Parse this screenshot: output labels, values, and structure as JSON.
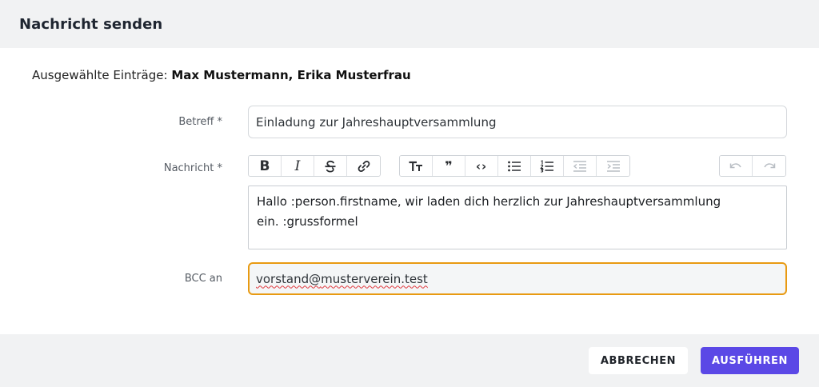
{
  "dialog": {
    "title": "Nachricht senden"
  },
  "selection": {
    "prefix": "Ausgewählte Einträge:",
    "names": "Max Mustermann, Erika Musterfrau"
  },
  "form": {
    "subject": {
      "label": "Betreff *",
      "value": "Einladung zur Jahreshauptversammlung"
    },
    "message": {
      "label": "Nachricht *",
      "line1": "Hallo :person.firstname, wir laden dich herzlich zur Jahreshauptversammlung",
      "line2": "ein. :grussformel"
    },
    "bcc": {
      "label": "BCC an",
      "value_plain": "vorstand@",
      "value_flagged": "musterverein.test"
    }
  },
  "toolbar": {
    "icons": [
      "bold-icon",
      "italic-icon",
      "strikethrough-icon",
      "link-icon",
      "heading-icon",
      "quote-icon",
      "code-icon",
      "bullet-list-icon",
      "numbered-list-icon",
      "outdent-icon",
      "indent-icon",
      "undo-icon",
      "redo-icon"
    ],
    "glyphs": {
      "bold": "B",
      "italic": "I",
      "quote": "❞",
      "code": "‹›"
    }
  },
  "actions": {
    "cancel": "ABBRECHEN",
    "run": "AUSFÜHREN"
  },
  "colors": {
    "accent": "#5b48e6",
    "focus": "#e89a12",
    "spellcheck": "#e0383e",
    "header_bg": "#f1f2f3"
  }
}
